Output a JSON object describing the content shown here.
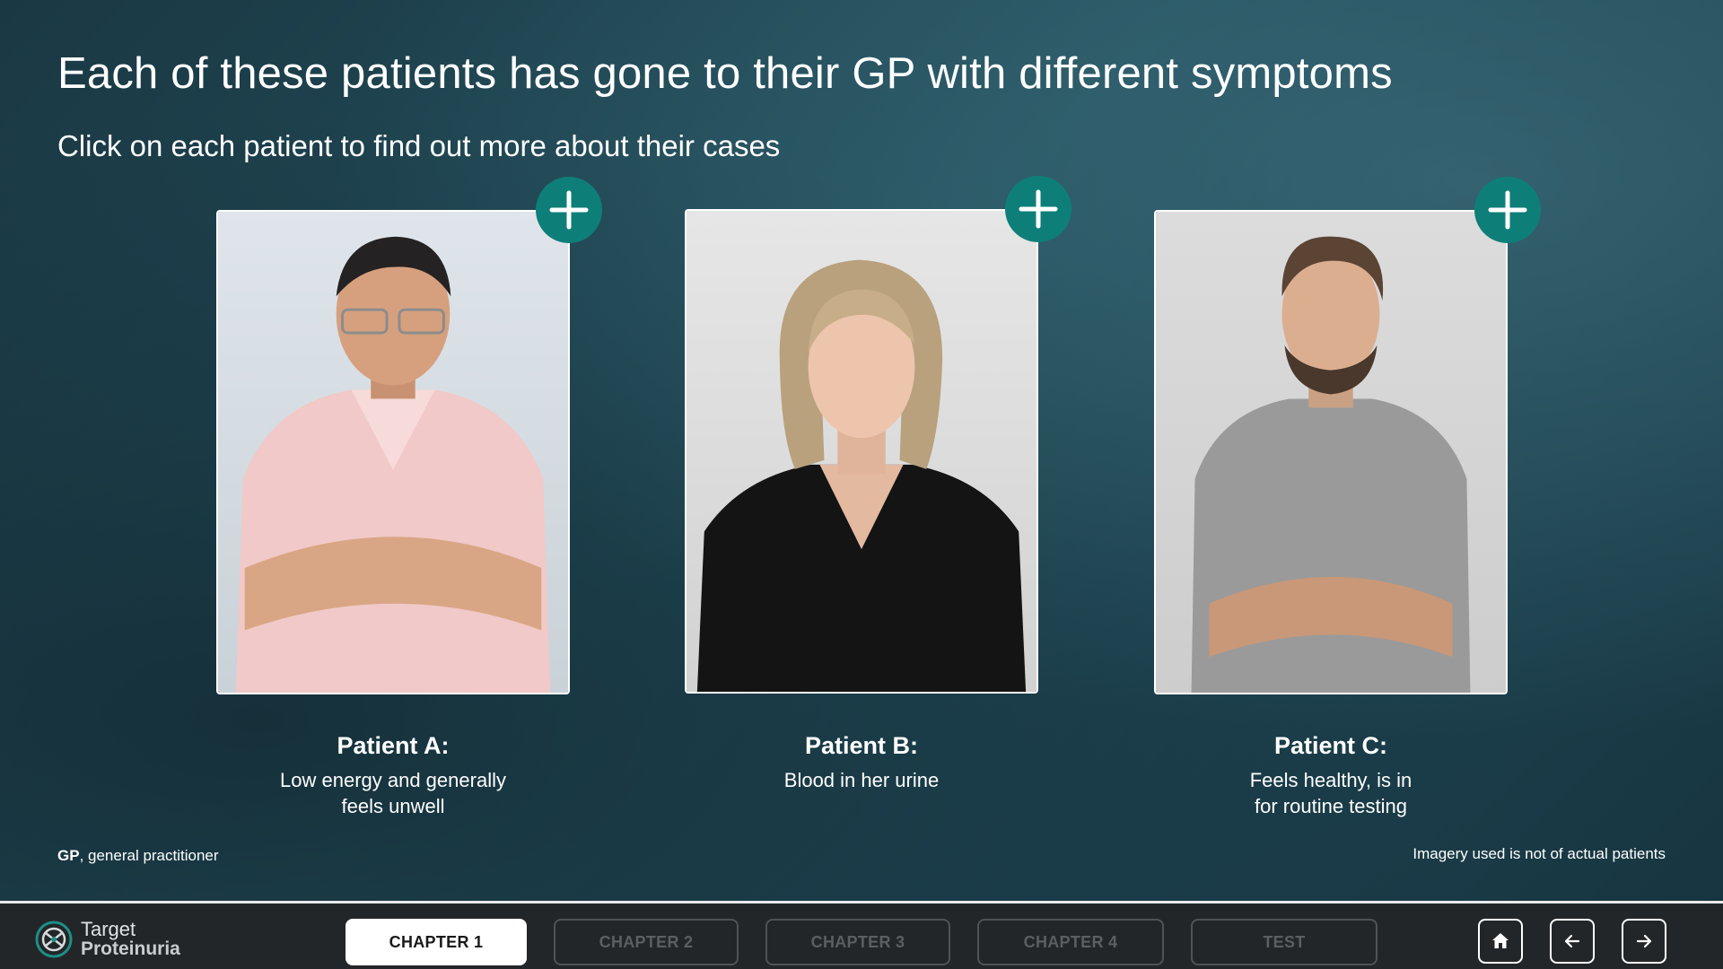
{
  "header": {
    "title": "Each of these patients has gone to their GP with different symptoms",
    "subtitle": "Click on each patient to find out more about their cases"
  },
  "patients": [
    {
      "name": "Patient A:",
      "description": "Low energy and generally\nfeels unwell",
      "expand_icon": "plus-icon"
    },
    {
      "name": "Patient B:",
      "description": "Blood in her urine",
      "expand_icon": "plus-icon"
    },
    {
      "name": "Patient C:",
      "description": "Feels healthy, is in\nfor routine testing",
      "expand_icon": "plus-icon"
    }
  ],
  "footer": {
    "abbrev_term": "GP",
    "abbrev_def": ", general practitioner",
    "disclaimer": "Imagery used is not of actual patients"
  },
  "nav": {
    "logo_line1": "Target",
    "logo_line2": "Proteinuria",
    "chapters": [
      {
        "label": "CHAPTER 1",
        "active": true
      },
      {
        "label": "CHAPTER 2",
        "active": false
      },
      {
        "label": "CHAPTER 3",
        "active": false
      },
      {
        "label": "CHAPTER 4",
        "active": false
      },
      {
        "label": "TEST",
        "active": false
      }
    ],
    "buttons": [
      "home-icon",
      "arrow-left-icon",
      "arrow-right-icon"
    ]
  },
  "colors": {
    "accent": "#0e7f78",
    "background": "#1b3a45",
    "navbar": "#232628"
  }
}
